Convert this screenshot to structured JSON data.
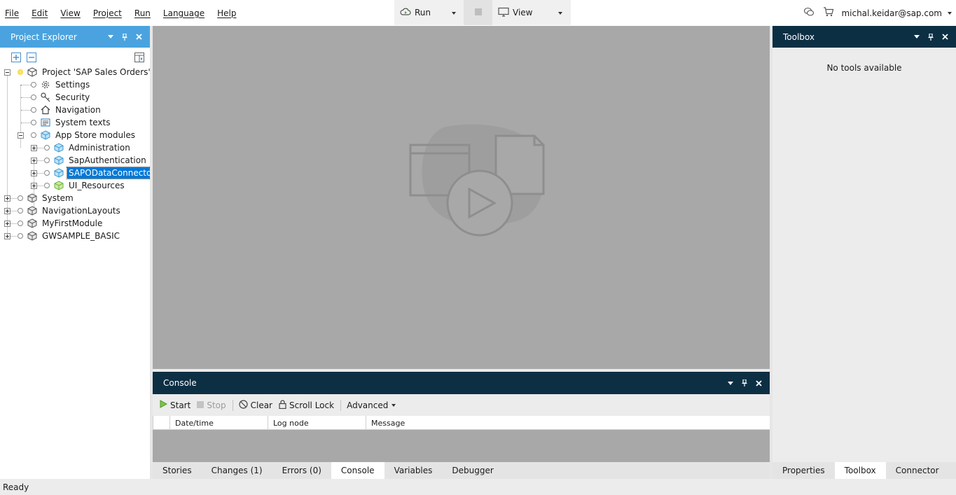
{
  "menu": [
    "File",
    "Edit",
    "View",
    "Project",
    "Run",
    "Language",
    "Help"
  ],
  "toolbar": {
    "run_label": "Run",
    "view_label": "View"
  },
  "user": {
    "email": "michal.keidar@sap.com"
  },
  "explorer": {
    "title": "Project Explorer",
    "tree": {
      "root": "Project 'SAP Sales Orders'",
      "children": [
        "Settings",
        "Security",
        "Navigation",
        "System texts",
        "App Store modules"
      ],
      "modules": [
        "Administration",
        "SapAuthentication",
        "SAPODataConnector",
        "UI_Resources"
      ],
      "siblings": [
        "System",
        "NavigationLayouts",
        "MyFirstModule",
        "GWSAMPLE_BASIC"
      ]
    }
  },
  "console": {
    "title": "Console",
    "tools": {
      "start": "Start",
      "stop": "Stop",
      "clear": "Clear",
      "scroll_lock": "Scroll Lock",
      "advanced": "Advanced"
    },
    "columns": [
      "",
      "Date/time",
      "Log node",
      "Message"
    ]
  },
  "bottom_tabs": [
    "Stories",
    "Changes (1)",
    "Errors (0)",
    "Console",
    "Variables",
    "Debugger"
  ],
  "toolbox": {
    "title": "Toolbox",
    "empty_text": "No tools available"
  },
  "right_tabs": [
    "Properties",
    "Toolbox",
    "Connector"
  ],
  "status": "Ready",
  "colors": {
    "explorer_header": "#4aa3df",
    "panel_header": "#0c2f44",
    "selection": "#0078d7",
    "editor_bg": "#a8a8a8"
  }
}
